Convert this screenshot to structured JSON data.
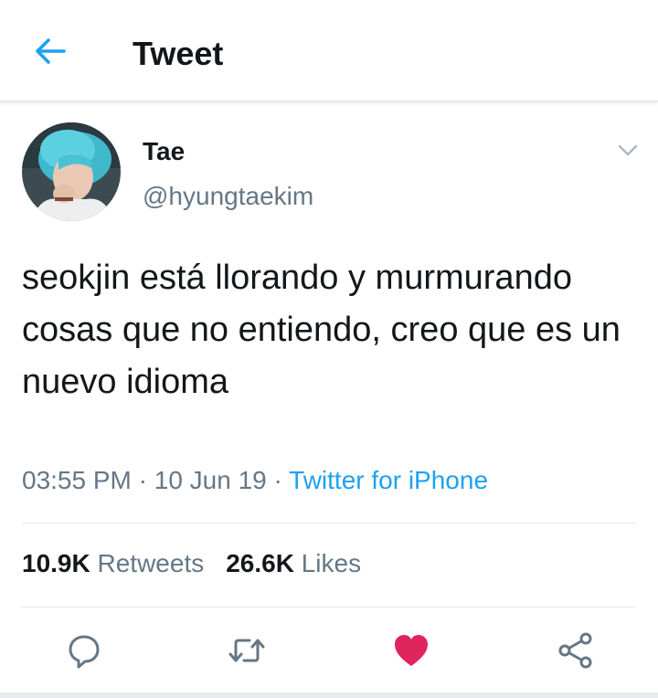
{
  "header": {
    "title": "Tweet",
    "back_icon": "arrow-left-icon"
  },
  "tweet": {
    "display_name": "Tae",
    "handle": "@hyungtaekim",
    "text": "seokjin está llorando y murmurando cosas que no entiendo, creo que es un nuevo idioma",
    "time": "03:55 PM",
    "separator": " · ",
    "date": "10 Jun 19",
    "source": "Twitter for iPhone",
    "retweet_count": "10.9K",
    "retweet_label": "Retweets",
    "like_count": "26.6K",
    "like_label": "Likes"
  },
  "actions": {
    "reply_icon": "reply-icon",
    "retweet_icon": "retweet-icon",
    "like_icon": "heart-icon",
    "share_icon": "share-icon"
  },
  "colors": {
    "accent": "#1da1f2",
    "like": "#e0245e",
    "secondary_text": "#657786",
    "divider": "#e1e8ed"
  }
}
